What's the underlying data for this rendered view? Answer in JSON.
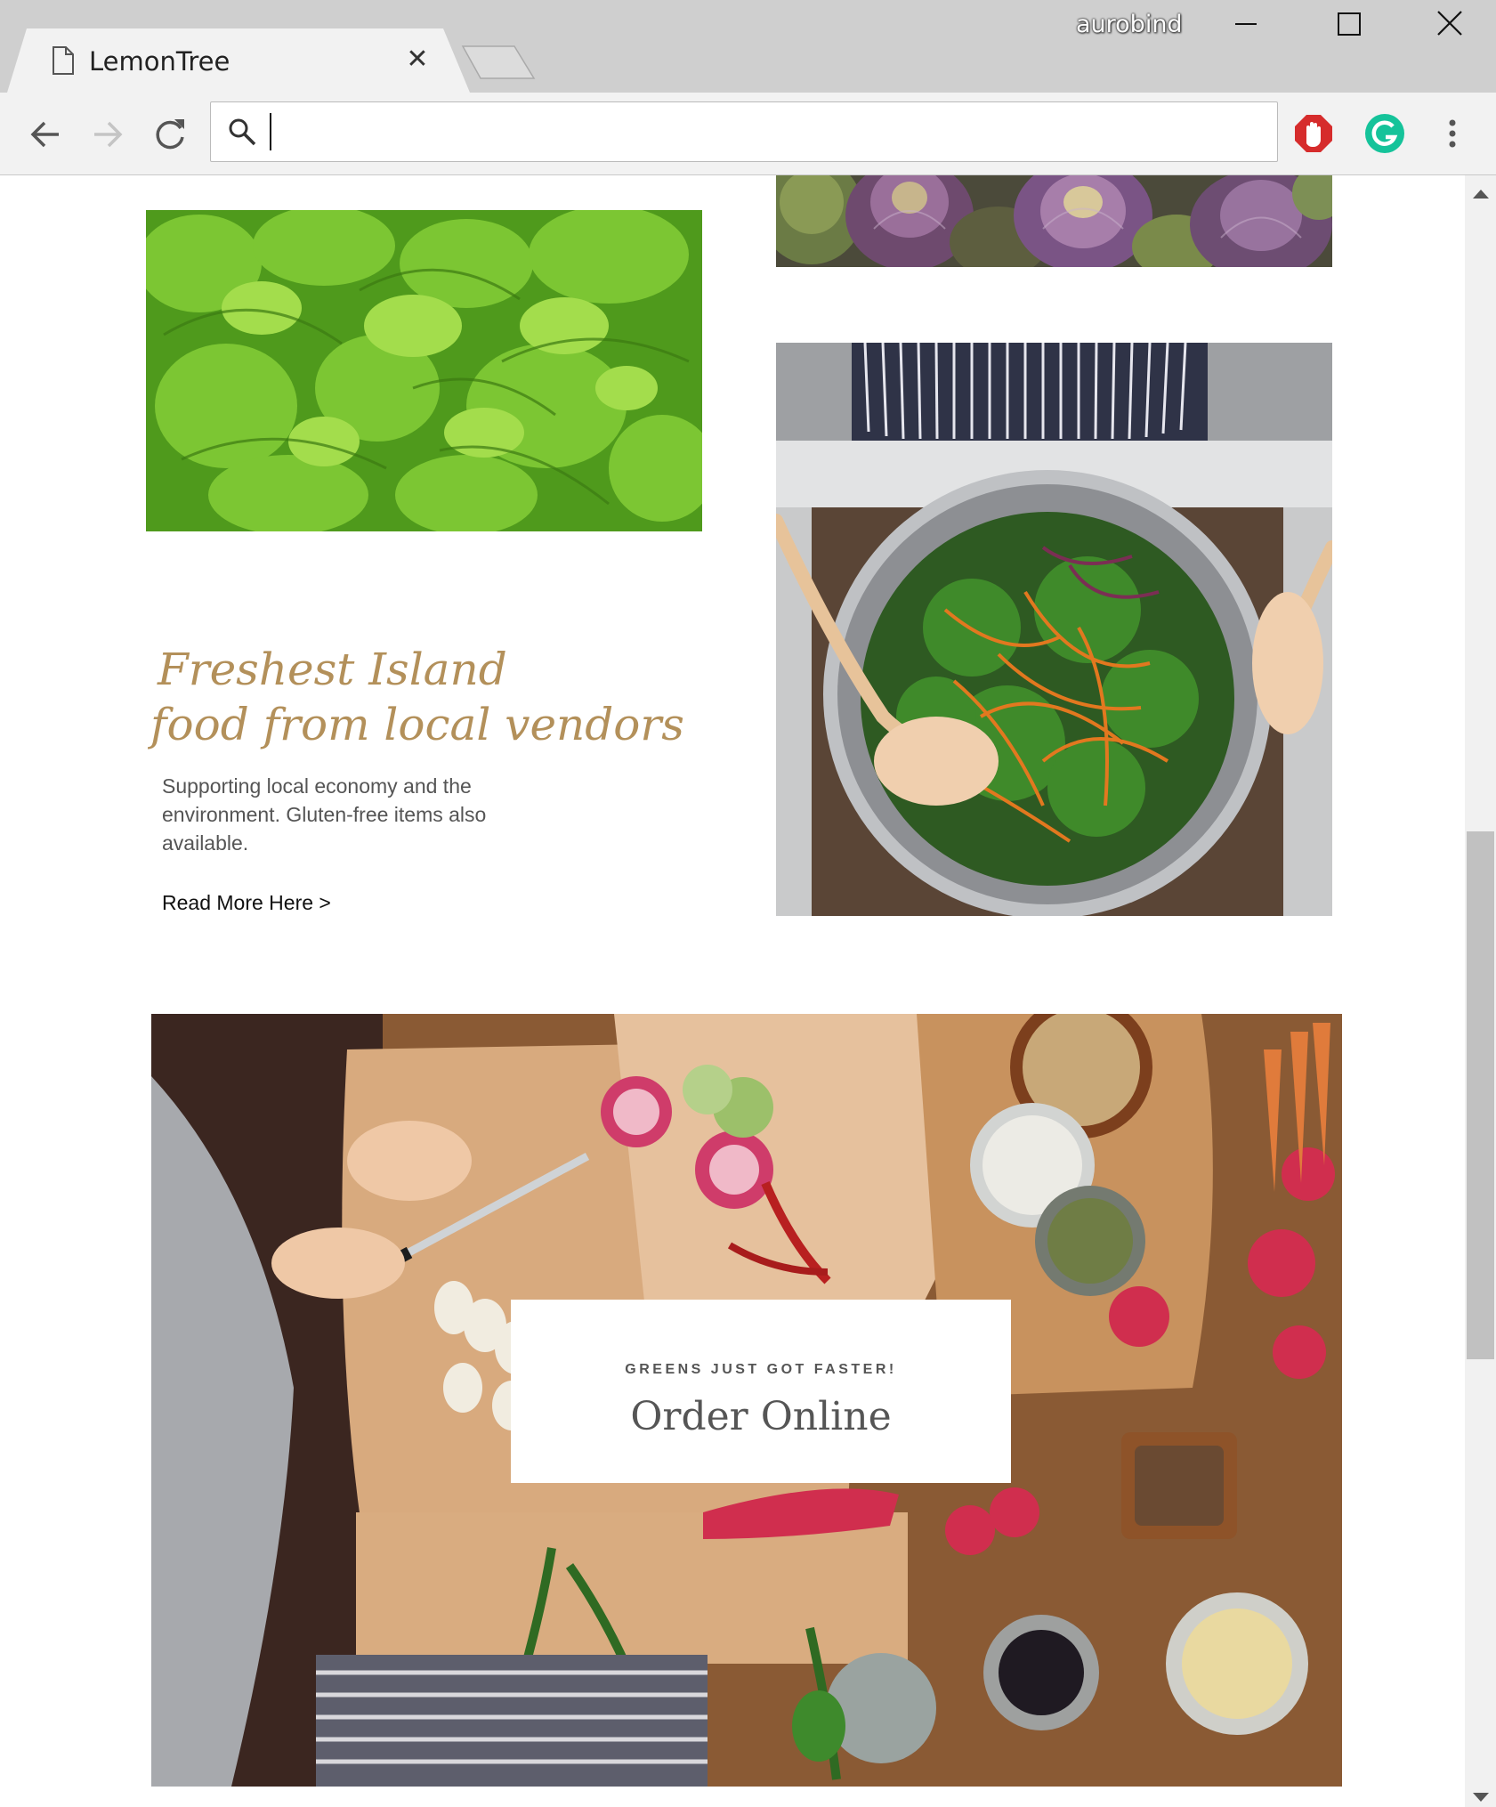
{
  "browser": {
    "tab_title": "LemonTree",
    "tab_close": "✕",
    "profile_name": "aurobind",
    "address_value": "",
    "colors": {
      "chrome_bg": "#cfcfcf",
      "toolbar_bg": "#f2f2f2",
      "adblock": "#d62c2c",
      "grammarly": "#15c39a"
    }
  },
  "feature": {
    "headline_line1": "Freshest Island",
    "headline_line2": "food from local vendors",
    "body": "Supporting local economy and the environment. Gluten-free items also available.",
    "link": "Read More Here >",
    "colors": {
      "headline": "#b3905a",
      "body": "#555555"
    }
  },
  "order": {
    "kicker": "GREENS JUST GOT FASTER!",
    "title": "Order Online"
  }
}
